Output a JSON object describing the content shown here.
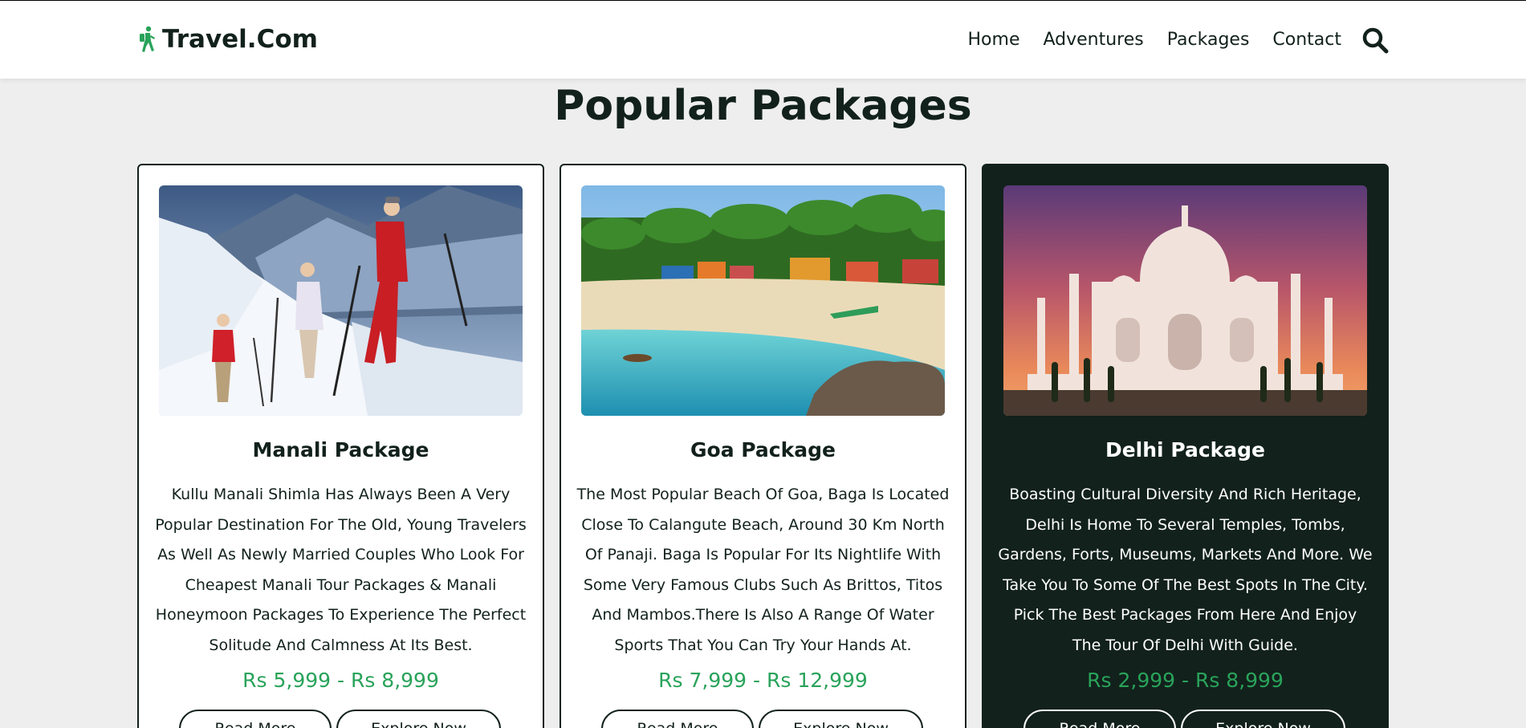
{
  "header": {
    "brand": "Travel.Com",
    "nav": [
      "Home",
      "Adventures",
      "Packages",
      "Contact"
    ]
  },
  "section": {
    "title": "Popular Packages"
  },
  "packages": [
    {
      "title": "Manali Package",
      "description": "Kullu Manali Shimla Has Always Been A Very Popular Destination For The Old, Young Travelers As Well As Newly Married Couples Who Look For Cheapest Manali Tour Packages & Manali Honeymoon Packages To Experience The Perfect Solitude And Calmness At Its Best.",
      "price": "Rs 5,999 - Rs 8,999",
      "read_more": "Read More",
      "explore": "Explore Now"
    },
    {
      "title": "Goa Package",
      "description": "The Most Popular Beach Of Goa, Baga Is Located Close To Calangute Beach, Around 30 Km North Of Panaji. Baga Is Popular For Its Nightlife With Some Very Famous Clubs Such As Brittos, Titos And Mambos.There Is Also A Range Of Water Sports That You Can Try Your Hands At.",
      "price": "Rs 7,999 - Rs 12,999",
      "read_more": "Read More",
      "explore": "Explore Now"
    },
    {
      "title": "Delhi Package",
      "description": "Boasting Cultural Diversity And Rich Heritage, Delhi Is Home To Several Temples, Tombs, Gardens, Forts, Museums, Markets And More. We Take You To Some Of The Best Spots In The City. Pick The Best Packages From Here And Enjoy The Tour Of Delhi With Guide.",
      "price": "Rs 2,999 - Rs 8,999",
      "read_more": "Read More",
      "explore": "Explore Now"
    }
  ],
  "icons": {
    "brand": "hiker-icon",
    "search": "search-icon"
  },
  "colors": {
    "primary_dark": "#12211c",
    "accent_green": "#29a35a",
    "background": "#eeeeee"
  }
}
